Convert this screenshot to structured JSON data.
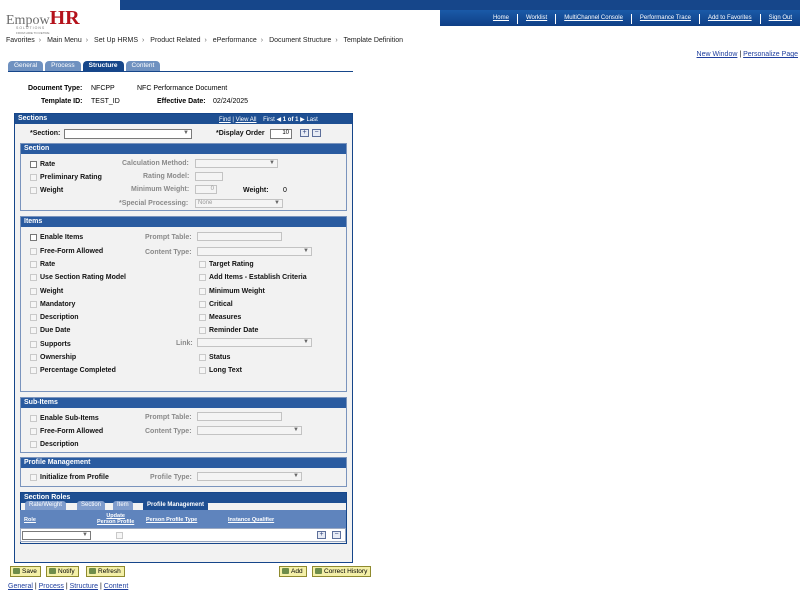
{
  "header": {
    "logo": {
      "prefix": "Empow",
      "suffix": "HR",
      "sub": "SOLUTIONS",
      "tagline": "FROM HIRE TO RETIRE"
    },
    "links": [
      "Home",
      "Worklist",
      "MultiChannel Console",
      "Performance Trace",
      "Add to Favorites",
      "Sign Out"
    ]
  },
  "breadcrumb": [
    "Favorites",
    "Main Menu",
    "Set Up HRMS",
    "Product Related",
    "ePerformance",
    "Document Structure",
    "Template Definition"
  ],
  "page_links": {
    "new_window": "New Window",
    "personalize": "Personalize Page"
  },
  "tabs": [
    "General",
    "Process",
    "Structure",
    "Content"
  ],
  "active_tab": "Structure",
  "doc": {
    "type_label": "Document Type:",
    "type_value": "NFCPP",
    "type_desc": "NFC Performance Document",
    "template_label": "Template ID:",
    "template_value": "TEST_ID",
    "effdate_label": "Effective Date:",
    "effdate_value": "02/24/2025"
  },
  "sections": {
    "title": "Sections",
    "nav": {
      "find": "Find",
      "view_all": "View All",
      "first": "First",
      "count": "1 of 1",
      "last": "Last"
    },
    "section_label": "*Section:",
    "section_value": "",
    "display_order_label": "*Display Order",
    "display_order_value": "10",
    "add": "+",
    "remove": "−"
  },
  "section_box": {
    "title": "Section",
    "rate": "Rate",
    "prelim": "Preliminary Rating",
    "weight": "Weight",
    "calc_method": "Calculation Method:",
    "rating_model": "Rating Model:",
    "min_weight": "Minimum Weight:",
    "min_weight_value": "0",
    "weight_label": "Weight:",
    "weight_value": "0",
    "special": "*Special Processing:",
    "special_value": "None"
  },
  "items_box": {
    "title": "Items",
    "left": [
      "Enable Items",
      "Free-Form Allowed",
      "Rate",
      "Use Section Rating Model",
      "Weight",
      "Mandatory",
      "Description",
      "Due Date",
      "Supports",
      "Ownership",
      "Percentage Completed"
    ],
    "right": [
      "Target Rating",
      "Add Items - Establish Criteria",
      "Minimum Weight",
      "Critical",
      "Measures",
      "Reminder Date",
      "Status",
      "Long Text"
    ],
    "prompt_table": "Prompt Table:",
    "content_type": "Content Type:",
    "link": "Link:"
  },
  "subitems_box": {
    "title": "Sub-Items",
    "left": [
      "Enable Sub-Items",
      "Free-Form Allowed",
      "Description"
    ],
    "prompt_table": "Prompt Table:",
    "content_type": "Content Type:"
  },
  "profile_box": {
    "title": "Profile Management",
    "init": "Initialize from Profile",
    "profile_type": "Profile Type:"
  },
  "roles": {
    "title": "Section Roles",
    "tabs": [
      "Rate/Weight",
      "Section",
      "Item",
      "Profile Management"
    ],
    "active_tab": "Profile Management",
    "columns": {
      "role": "Role",
      "update_line1": "Update",
      "update_line2": "Person Profile",
      "profile_type": "Person Profile Type",
      "qualifier": "Instance Qualifier"
    },
    "role_value": ""
  },
  "buttons": {
    "save": "Save",
    "notify": "Notify",
    "refresh": "Refresh",
    "add": "Add",
    "correct_history": "Correct History"
  },
  "footer_links": [
    "General",
    "Process",
    "Structure",
    "Content"
  ],
  "colors": {
    "header_blue": "#16468a",
    "section_head": "#1e4f92",
    "button_yellow": "#f4f0a8"
  }
}
